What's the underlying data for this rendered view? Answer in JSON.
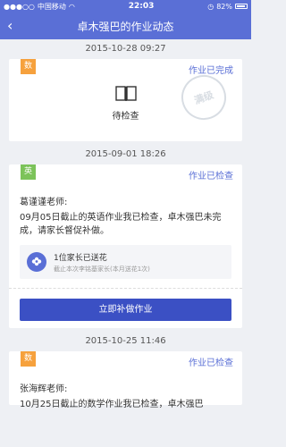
{
  "statusbar": {
    "carrier": "中国移动",
    "signal": "●●●○○",
    "time": "22:03",
    "battery": "82%"
  },
  "header": {
    "back": "‹",
    "title": "卓木强巴的作业动态"
  },
  "items": [
    {
      "timestamp": "2015-10-28 09:27",
      "subject": "数",
      "status": "作业已完成",
      "stamp": "满级",
      "pending_label": "待检查"
    },
    {
      "timestamp": "2015-09-01 18:26",
      "subject": "英",
      "status": "作业已检查",
      "teacher": "葛谨谨老师:",
      "message": "09月05日截止的英语作业我已检查，卓木强巴未完成，请家长督促补做。",
      "flower": {
        "title": "1位家长已送花",
        "subtitle": "截止本次李铭基家长(本月送花1次)"
      },
      "action": "立即补做作业"
    },
    {
      "timestamp": "2015-10-25 11:46",
      "subject": "数",
      "status": "作业已检查",
      "teacher": "张海辉老师:",
      "message": "10月25日截止的数学作业我已检查，卓木强巴"
    }
  ]
}
